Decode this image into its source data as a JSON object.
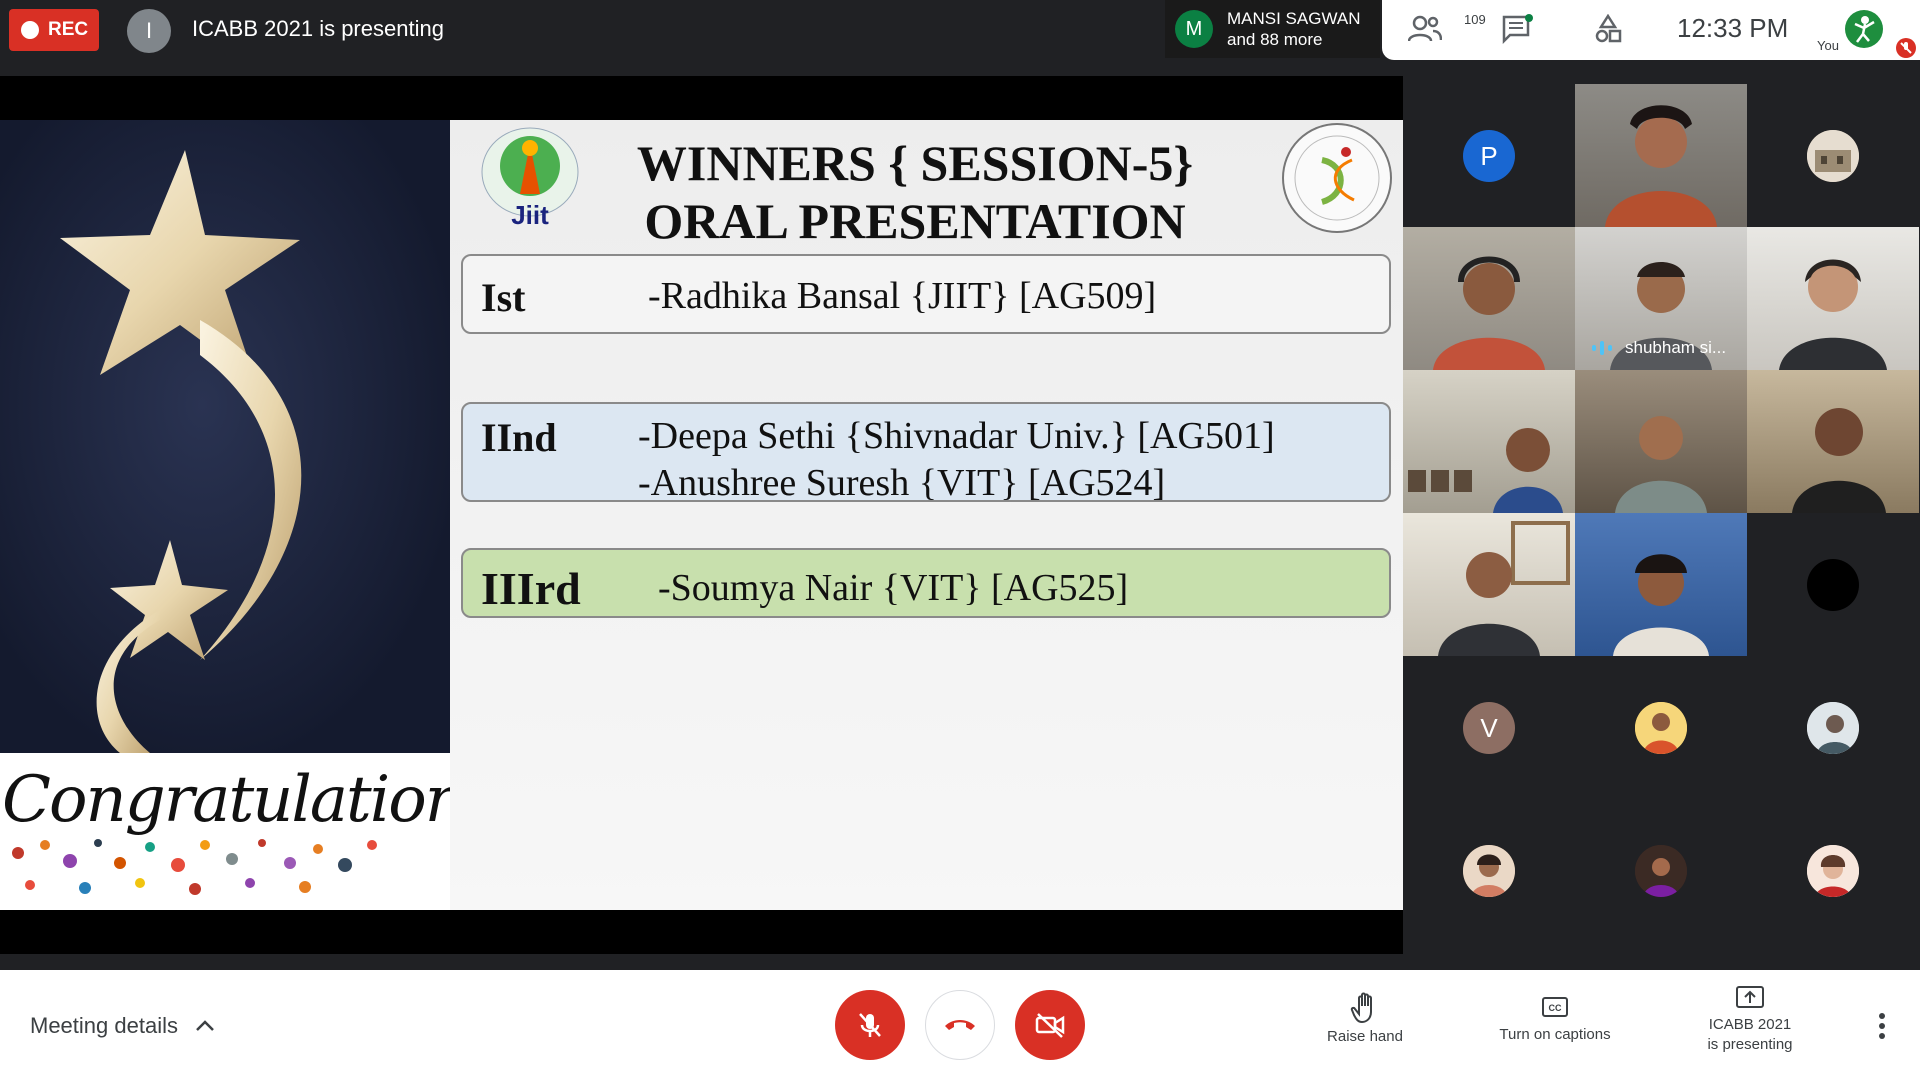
{
  "top_bar": {
    "rec_label": "REC",
    "presenter_initial": "I",
    "presenting_title": "ICABB 2021 is presenting",
    "joined_initial": "M",
    "joined_name": "MANSI SAGWAN",
    "joined_more": "and 88 more",
    "people_count": "109",
    "clock": "12:33  PM",
    "you_label": "You"
  },
  "slide": {
    "title_line1": "WINNERS { SESSION-5}",
    "title_line2": "ORAL PRESENTATION",
    "congrats_text": "Congratulations",
    "winners": [
      {
        "rank": "Ist",
        "names": [
          "-Radhika Bansal {JIIT} [AG509]"
        ],
        "color": "#f4f4f4"
      },
      {
        "rank": "IInd",
        "names": [
          "-Deepa Sethi {Shivnadar Univ.} [AG501]",
          "-Anushree Suresh {VIT} [AG524]"
        ],
        "color": "#dce7f2"
      },
      {
        "rank": "IIIrd",
        "names": [
          "-Soumya Nair {VIT} [AG525]"
        ],
        "color": "#c8e0ad"
      }
    ]
  },
  "participants": {
    "tile_p_initial": "P",
    "speaker_name": "shubham si...",
    "tile_v_initial": "V"
  },
  "bottom_bar": {
    "meeting_details": "Meeting details",
    "raise_hand": "Raise hand",
    "captions": "Turn on captions",
    "presenting_line1": "ICABB 2021",
    "presenting_line2": "is presenting"
  },
  "colors": {
    "end_call_red": "#d93025",
    "accent_blue": "#1a73e8"
  }
}
